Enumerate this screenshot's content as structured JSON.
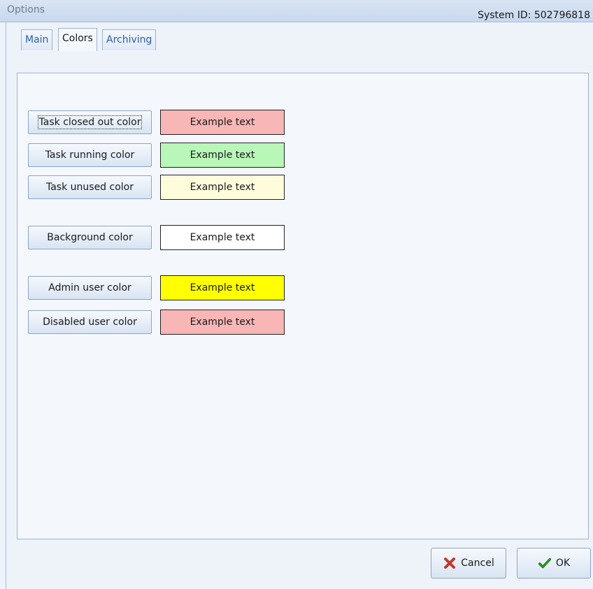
{
  "window": {
    "title": "Options"
  },
  "header": {
    "system_id": "System ID: 502796818"
  },
  "tabs": [
    {
      "label": "Main",
      "active": false
    },
    {
      "label": "Colors",
      "active": true
    },
    {
      "label": "Archiving",
      "active": false
    }
  ],
  "color_rows": [
    {
      "button_label": "Task closed out color",
      "example_text": "Example text",
      "color": "#f9b6b6"
    },
    {
      "button_label": "Task running color",
      "example_text": "Example text",
      "color": "#b8f7b8"
    },
    {
      "button_label": "Task unused color",
      "example_text": "Example text",
      "color": "#fffcdc"
    },
    {
      "button_label": "Background color",
      "example_text": "Example text",
      "color": "#ffffff"
    },
    {
      "button_label": "Admin user color",
      "example_text": "Example text",
      "color": "#ffff00"
    },
    {
      "button_label": "Disabled user color",
      "example_text": "Example text",
      "color": "#f9b6b6"
    }
  ],
  "footer": {
    "cancel_label": "Cancel",
    "ok_label": "OK"
  },
  "icons": {
    "cancel": "x-icon",
    "ok": "check-icon"
  },
  "colors": {
    "cancel_icon": "#c0392b",
    "ok_icon": "#2e8b1f",
    "tab_text": "#2a5ea8"
  }
}
